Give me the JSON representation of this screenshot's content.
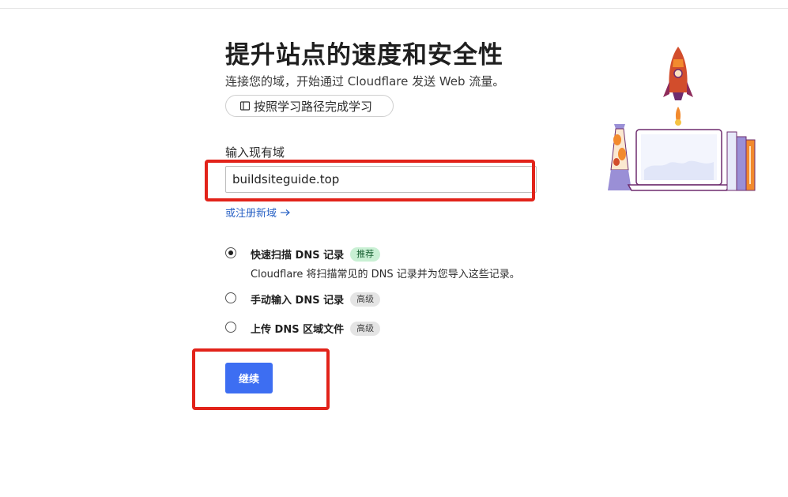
{
  "header": {
    "title": "提升站点的速度和安全性",
    "subtitle": "连接您的域，开始通过 Cloudflare 发送 Web 流量。",
    "learn_button": {
      "label": "按照学习路径完成学习",
      "icon": "book-icon"
    }
  },
  "domain_form": {
    "label": "输入现有域",
    "value": "buildsiteguide.top",
    "register_link": {
      "label": "或注册新域",
      "icon": "arrow-right-icon"
    }
  },
  "options": [
    {
      "title": "快速扫描 DNS 记录",
      "badge": "推荐",
      "description": "Cloudflare 将扫描常见的 DNS 记录并为您导入这些记录。",
      "selected": true
    },
    {
      "title": "手动输入 DNS 记录",
      "badge": "高级",
      "selected": false
    },
    {
      "title": "上传 DNS 区域文件",
      "badge": "高级",
      "selected": false
    }
  ],
  "continue_button": {
    "label": "继续"
  },
  "colors": {
    "primary_button": "#3d6ef2",
    "link": "#2c64c6",
    "highlight_annotation": "#e2231a",
    "badge_recommend_bg": "#c9f0d4",
    "badge_advanced_bg": "#e4e4e4"
  }
}
